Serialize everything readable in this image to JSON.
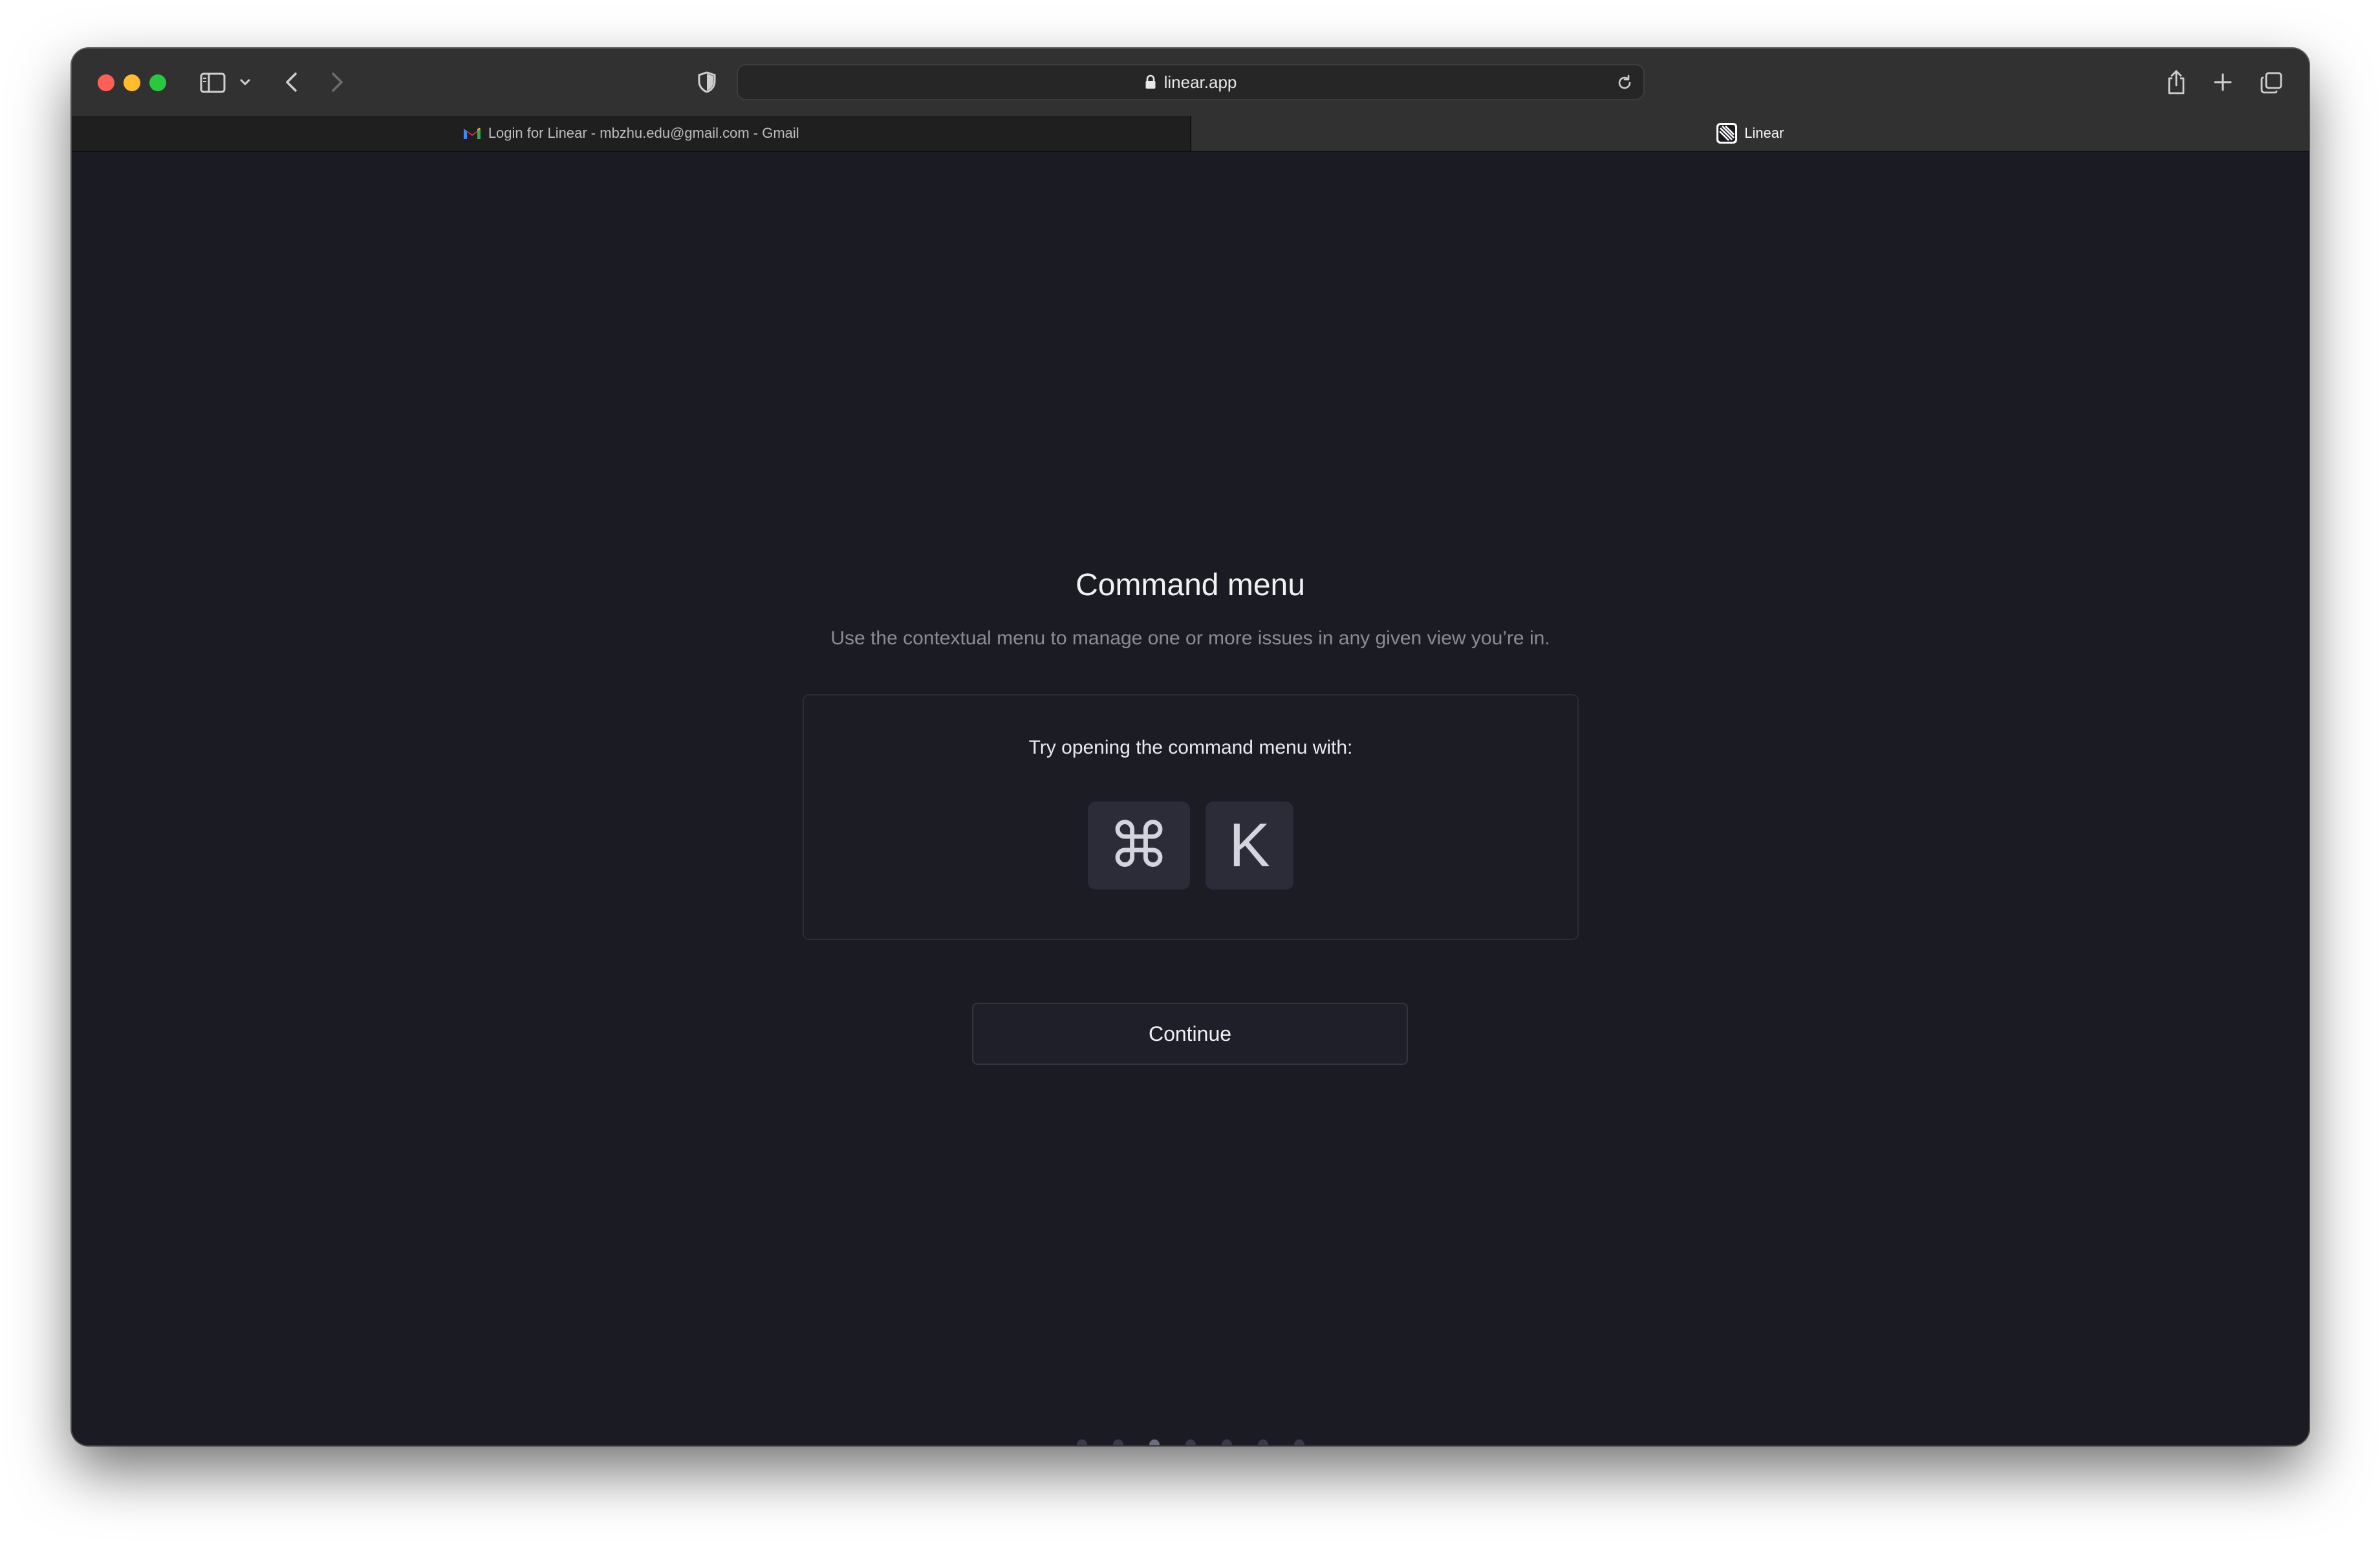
{
  "browser": {
    "url": "linear.app",
    "tabs": [
      {
        "label": "Login for Linear - mbzhu.edu@gmail.com - Gmail",
        "active": false,
        "icon": "gmail-icon"
      },
      {
        "label": "Linear",
        "active": true,
        "icon": "linear-logo-icon"
      }
    ]
  },
  "onboarding": {
    "title": "Command menu",
    "subtitle": "Use the contextual menu to manage one or more issues in any given view you’re in.",
    "card_prompt": "Try opening the command menu with:",
    "keys": [
      "⌘",
      "K"
    ],
    "continue_label": "Continue",
    "step_total": 7,
    "step_current": 3
  },
  "colors": {
    "background": "#1b1b24",
    "toolbar": "#313131",
    "key_bg": "#2b2c38"
  }
}
